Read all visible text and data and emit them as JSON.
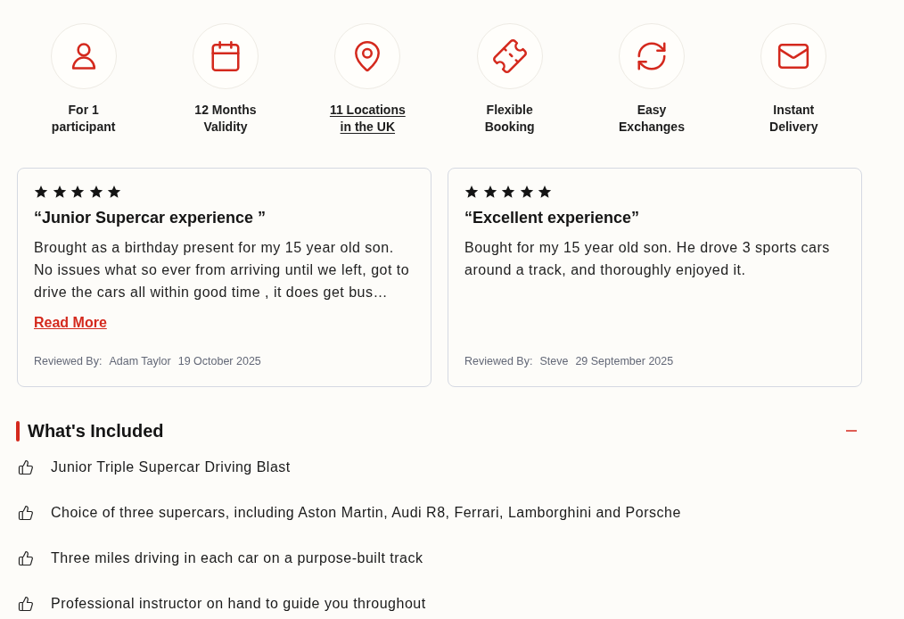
{
  "features": [
    {
      "label": "For 1 participant",
      "kind": "text"
    },
    {
      "label": "12 Months Validity",
      "kind": "text"
    },
    {
      "label": "11 Locations in the UK",
      "kind": "link"
    },
    {
      "label": "Flexible Booking",
      "kind": "text"
    },
    {
      "label": "Easy Exchanges",
      "kind": "text"
    },
    {
      "label": "Instant Delivery",
      "kind": "text"
    }
  ],
  "reviews": [
    {
      "stars": 5,
      "title": "“Junior Supercar experience ”",
      "body": "Brought as a birthday present for my 15 year old son. No issues what so ever from arriving until we left, got to drive the cars all within good time , it does get bus…",
      "read_more": "Read More",
      "reviewed_by_label": "Reviewed By:",
      "reviewer": "Adam Taylor",
      "date": "19 October 2025"
    },
    {
      "stars": 5,
      "title": "“Excellent experience”",
      "body": "Bought for my 15 year old son. He drove 3 sports cars around a track, and thoroughly enjoyed it.",
      "reviewed_by_label": "Reviewed By:",
      "reviewer": "Steve",
      "date": "29 September 2025"
    }
  ],
  "included": {
    "title": "What's Included",
    "expanded": true,
    "items": [
      "Junior Triple Supercar Driving Blast",
      "Choice of three supercars, including Aston Martin, Audi R8, Ferrari, Lamborghini and Porsche",
      "Three miles driving in each car on a purpose-built track",
      "Professional instructor on hand to guide you throughout"
    ]
  }
}
